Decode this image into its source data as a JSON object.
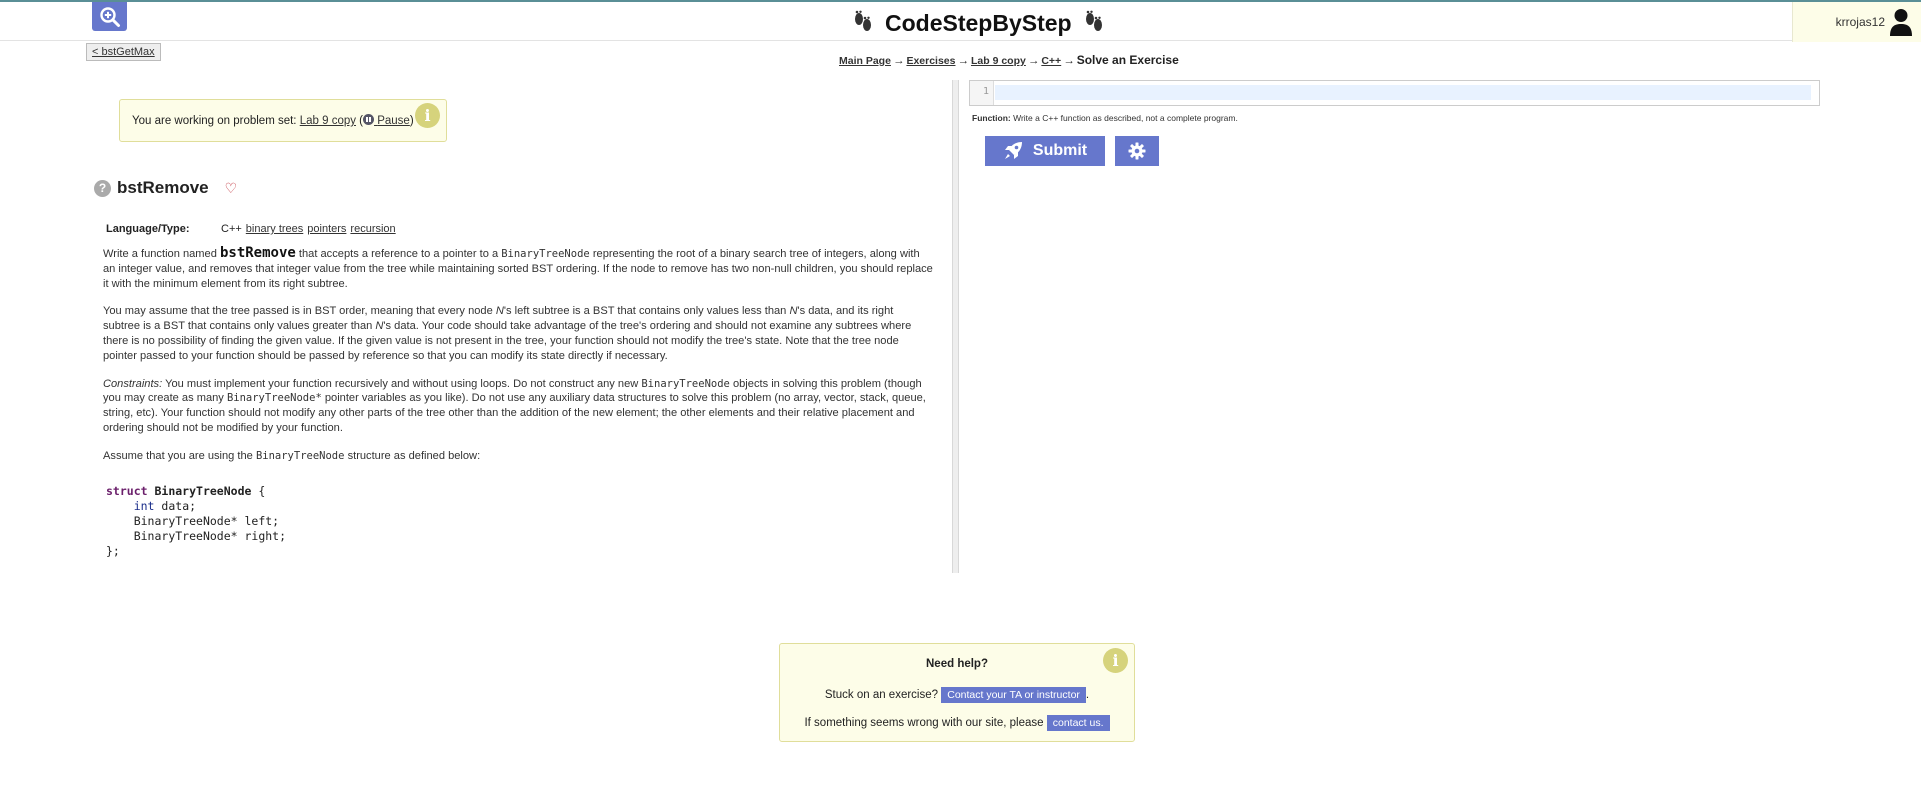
{
  "header": {
    "brand": "CodeStepByStep",
    "username": "krrojas12"
  },
  "nav": {
    "back_label": "< bstGetMax",
    "breadcrumbs": [
      "Main Page",
      "Exercises",
      "Lab 9 copy",
      "C++"
    ],
    "current": "Solve an Exercise"
  },
  "notice": {
    "prefix": "You are working on problem set:",
    "set_name": "Lab 9 copy",
    "pause_label": "Pause"
  },
  "problem": {
    "title": "bstRemove",
    "language_label": "Language/Type:",
    "language": "C++",
    "tags": [
      "binary trees",
      "pointers",
      "recursion"
    ],
    "p1_a": "Write a function named",
    "p1_name": "bstRemove",
    "p1_b": "that accepts a reference to a pointer to a",
    "p1_type": "BinaryTreeNode",
    "p1_c": "representing the root of a binary search tree of integers, along with an integer value, and removes that integer value from the tree while maintaining sorted BST ordering. If the node to remove has two non-null children, you should replace it with the minimum element from its right subtree.",
    "p2_a": "You may assume that the tree passed is in BST order, meaning that every node",
    "p2_n1": "N",
    "p2_b": "'s left subtree is a BST that contains only values less than",
    "p2_n2": "N",
    "p2_c": "'s data, and its right subtree is a BST that contains only values greater than",
    "p2_n3": "N",
    "p2_d": "'s data. Your code should take advantage of the tree's ordering and should not examine any subtrees where there is no possibility of finding the given value. If the given value is not present in the tree, your function should not modify the tree's state. Note that the tree node pointer passed to your function should be passed by reference so that you can modify its state directly if necessary.",
    "p3_label": "Constraints:",
    "p3_a": "You must implement your function recursively and without using loops. Do not construct any new",
    "p3_type": "BinaryTreeNode",
    "p3_b": "objects in solving this problem (though you may create as many",
    "p3_type2": "BinaryTreeNode*",
    "p3_c": "pointer variables as you like). Do not use any auxiliary data structures to solve this problem (no array, vector, stack, queue, string, etc). Your function should not modify any other parts of the tree other than the addition of the new element; the other elements and their relative placement and ordering should not be modified by your function.",
    "p4_a": "Assume that you are using the",
    "p4_type": "BinaryTreeNode",
    "p4_b": "structure as defined below:",
    "code": {
      "l1_kw": "struct",
      "l1_name": "BinaryTreeNode",
      "l1_brace": "{",
      "l2_type": "int",
      "l2_rest": "data;",
      "l3": "BinaryTreeNode* left;",
      "l4": "BinaryTreeNode* right;",
      "l5": "};"
    }
  },
  "editor": {
    "line_number": "1",
    "function_label": "Function:",
    "function_note": "Write a C++ function as described, not a complete program.",
    "submit_label": "Submit"
  },
  "help": {
    "title": "Need help?",
    "stuck_text": "Stuck on an exercise?",
    "contact_ta": "Contact your TA or instructor",
    "wrong_text": "If something seems wrong with our site, please",
    "contact_us": "contact us."
  },
  "colors": {
    "accent": "#6677cc",
    "notice_bg": "#fdfde8",
    "info_badge": "#d6d37c",
    "top_border": "#5a8f96"
  }
}
